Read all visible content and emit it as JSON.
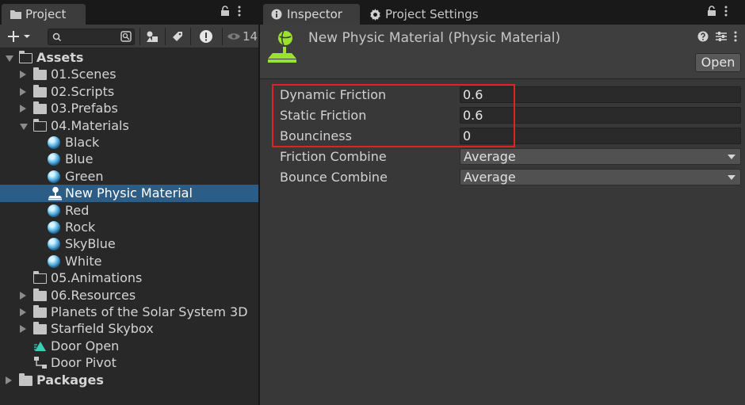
{
  "project_panel": {
    "tab_label": "Project",
    "visibility_count": "14",
    "tree": [
      {
        "label": "Assets",
        "depth": 0,
        "expanded": true,
        "kind": "folder-open",
        "bold": true
      },
      {
        "label": "01.Scenes",
        "depth": 1,
        "expanded": false,
        "kind": "folder"
      },
      {
        "label": "02.Scripts",
        "depth": 1,
        "expanded": false,
        "kind": "folder"
      },
      {
        "label": "03.Prefabs",
        "depth": 1,
        "expanded": false,
        "kind": "folder"
      },
      {
        "label": "04.Materials",
        "depth": 1,
        "expanded": true,
        "kind": "folder-open"
      },
      {
        "label": "Black",
        "depth": 2,
        "kind": "material"
      },
      {
        "label": "Blue",
        "depth": 2,
        "kind": "material"
      },
      {
        "label": "Green",
        "depth": 2,
        "kind": "material"
      },
      {
        "label": "New Physic Material",
        "depth": 2,
        "kind": "physic-material",
        "selected": true
      },
      {
        "label": "Red",
        "depth": 2,
        "kind": "material"
      },
      {
        "label": "Rock",
        "depth": 2,
        "kind": "material"
      },
      {
        "label": "SkyBlue",
        "depth": 2,
        "kind": "material"
      },
      {
        "label": "White",
        "depth": 2,
        "kind": "material"
      },
      {
        "label": "05.Animations",
        "depth": 1,
        "kind": "folder-empty"
      },
      {
        "label": "06.Resources",
        "depth": 1,
        "expanded": false,
        "kind": "folder"
      },
      {
        "label": "Planets of the Solar System 3D",
        "depth": 1,
        "expanded": false,
        "kind": "folder"
      },
      {
        "label": "Starfield Skybox",
        "depth": 1,
        "expanded": false,
        "kind": "folder"
      },
      {
        "label": "Door Open",
        "depth": 1,
        "kind": "animation-clip"
      },
      {
        "label": "Door Pivot",
        "depth": 1,
        "kind": "animator-controller"
      },
      {
        "label": "Packages",
        "depth": 0,
        "expanded": false,
        "kind": "folder",
        "bold": true
      }
    ]
  },
  "inspector": {
    "tab_label": "Inspector",
    "settings_tab_label": "Project Settings",
    "title": "New Physic Material (Physic Material)",
    "open_button": "Open",
    "properties": [
      {
        "label": "Dynamic Friction",
        "value": "0.6",
        "type": "float"
      },
      {
        "label": "Static Friction",
        "value": "0.6",
        "type": "float"
      },
      {
        "label": "Bounciness",
        "value": "0",
        "type": "float"
      },
      {
        "label": "Friction Combine",
        "value": "Average",
        "type": "dropdown"
      },
      {
        "label": "Bounce Combine",
        "value": "Average",
        "type": "dropdown"
      }
    ]
  },
  "colors": {
    "selection": "#2c5d87",
    "highlight_box": "#e0202a",
    "physic_material_icon": "#9be132"
  }
}
